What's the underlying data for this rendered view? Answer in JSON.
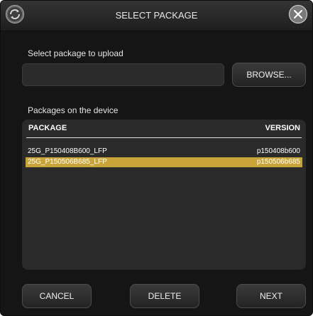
{
  "dialog": {
    "title": "SELECT PACKAGE"
  },
  "upload": {
    "label": "Select package to upload",
    "value": "",
    "browse_label": "BROWSE..."
  },
  "packages": {
    "label": "Packages on the device",
    "columns": {
      "package": "PACKAGE",
      "version": "VERSION"
    },
    "rows": [
      {
        "package": "25G_P150408B600_LFP",
        "version": "p150408b600",
        "selected": false
      },
      {
        "package": "25G_P150506B685_LFP",
        "version": "p150506b685",
        "selected": true
      }
    ]
  },
  "footer": {
    "cancel_label": "CANCEL",
    "delete_label": "DELETE",
    "next_label": "NEXT"
  },
  "icons": {
    "app": "refresh-gear-icon",
    "close": "close-circle-icon"
  },
  "colors": {
    "selection": "#c9a539",
    "background": "#151515",
    "panel": "#2a2a2a"
  }
}
